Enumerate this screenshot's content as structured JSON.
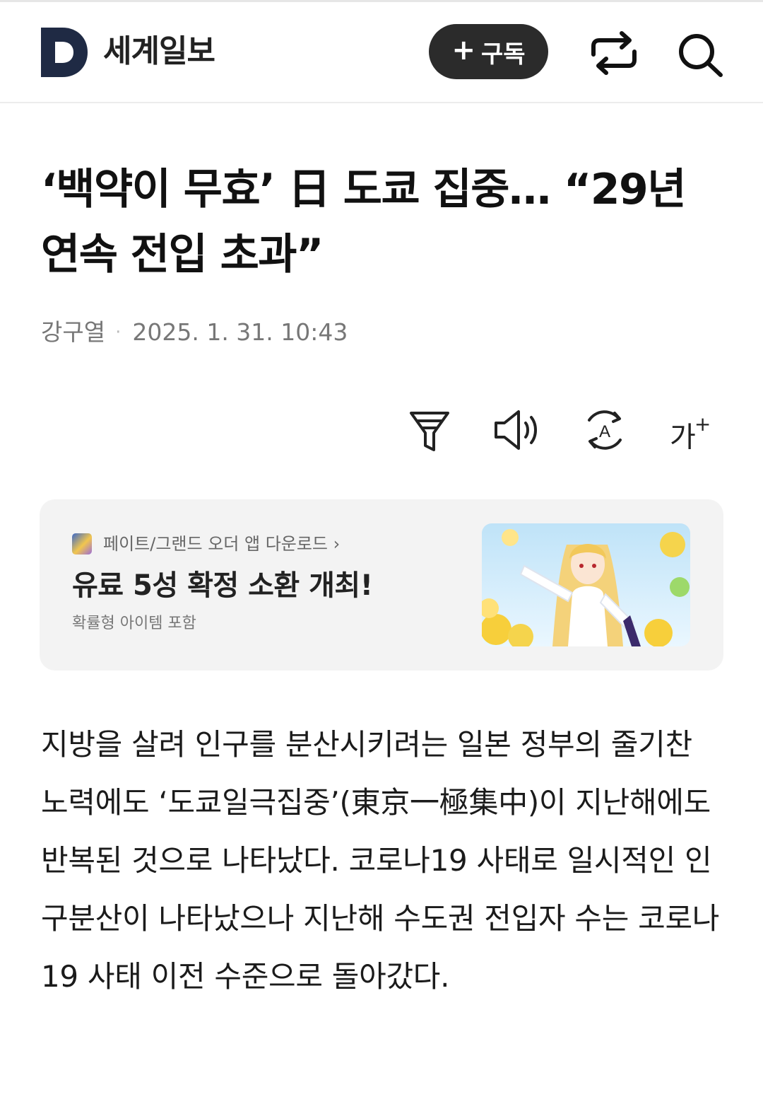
{
  "header": {
    "logo_letter": "D",
    "brand": "세계일보",
    "subscribe_plus": "+",
    "subscribe_label": "구독"
  },
  "article": {
    "headline": "‘백약이 무효’ 日 도쿄 집중… “29년 연속 전입 초과”",
    "author": "강구열",
    "separator": "·",
    "datetime": "2025. 1. 31. 10:43",
    "body": "지방을 살려 인구를 분산시키려는 일본 정부의 줄기찬 노력에도 ‘도쿄일극집중’(東京一極集中)이 지난해에도 반복된 것으로 나타났다. 코로나19 사태로 일시적인 인구분산이 나타났으나 지난해 수도권 전입자 수는 코로나19 사태 이전 수준으로 돌아갔다."
  },
  "toolbar": {
    "icons": [
      "filter-icon",
      "speaker-icon",
      "translate-icon",
      "font-size-icon"
    ],
    "font_size_label": "가",
    "font_size_plus": "+",
    "translate_letter": "A"
  },
  "ad": {
    "app_icon": "netmarble-app-icon",
    "source": "페이트/그랜드 오더 앱 다운로드 ›",
    "title": "유료 5성 확정 소환 개최!",
    "subtitle": "확률형 아이템 포함"
  },
  "colors": {
    "brand_navy": "#1f2a44",
    "subscribe_bg": "#2b2b2b",
    "ad_bg": "#f3f3f3",
    "meta_text": "#777777"
  }
}
